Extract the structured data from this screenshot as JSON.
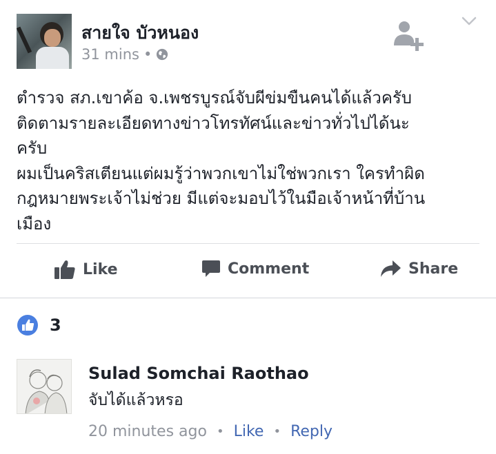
{
  "post": {
    "author_name": "สายใจ บัวหนอง",
    "time": "31 mins",
    "separator": "•",
    "audience_icon": "globe-icon",
    "lines": [
      "ตำรวจ สภ.เขาค้อ จ.เพชรบูรณ์จับผีข่มขืนคนได้แล้วครับ",
      "ติดตามรายละเอียดทางข่าวโทรทัศน์และข่าวทั่วไปได้นะ",
      "ครับ",
      "ผมเป็นคริสเตียนแต่ผมรู้ว่าพวกเขาไม่ใช่พวกเรา ใครทำผิด",
      "กฎหมายพระเจ้าไม่ช่วย มีแต่จะมอบไว้ในมือเจ้าหน้าที่บ้าน",
      "เมือง"
    ]
  },
  "actions": {
    "like_label": "Like",
    "comment_label": "Comment",
    "share_label": "Share"
  },
  "reactions": {
    "icon": "like-badge-icon",
    "count": "3"
  },
  "comment": {
    "author_name": "Sulad Somchai Raothao",
    "text": "จับได้แล้วหรอ",
    "time": "20 minutes ago",
    "separator": "•",
    "like_label": "Like",
    "reply_label": "Reply"
  },
  "colors": {
    "text": "#1d2129",
    "meta": "#90949c",
    "action": "#4b4f56",
    "link": "#4267b2",
    "like_badge": "#4a7fe0",
    "divider": "#dddfe2"
  }
}
